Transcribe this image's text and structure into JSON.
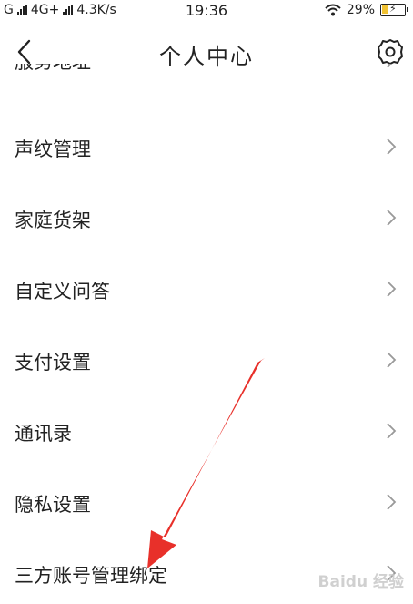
{
  "status_bar": {
    "carrier1": "G",
    "carrier2": "4G+",
    "speed": "4.3K/s",
    "time": "19:36",
    "battery": "29%",
    "battery_level": 0.29
  },
  "header": {
    "title": "个人中心",
    "back_icon": "chevron-left-icon",
    "settings_icon": "gear-icon"
  },
  "menu": {
    "items": [
      {
        "label": "服务地址"
      },
      {
        "label": "声纹管理"
      },
      {
        "label": "家庭货架"
      },
      {
        "label": "自定义问答"
      },
      {
        "label": "支付设置"
      },
      {
        "label": "通讯录"
      },
      {
        "label": "隐私设置"
      },
      {
        "label": "三方账号管理绑定"
      }
    ]
  },
  "annotation": {
    "color": "#e8302a"
  },
  "watermark": {
    "text": "Baidu 经验"
  }
}
